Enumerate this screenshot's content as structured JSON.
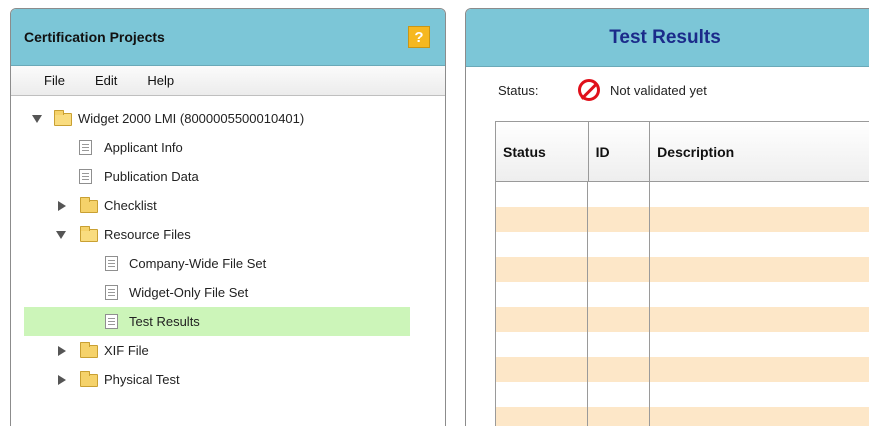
{
  "left_panel": {
    "title": "Certification Projects",
    "help_label": "?",
    "menu": [
      {
        "label": "File"
      },
      {
        "label": "Edit"
      },
      {
        "label": "Help"
      }
    ],
    "tree": [
      {
        "label": "Widget 2000 LMI (8000005500010401)",
        "type": "folder",
        "expanded": true,
        "depth": 0
      },
      {
        "label": "Applicant Info",
        "type": "doc",
        "depth": 1
      },
      {
        "label": "Publication Data",
        "type": "doc",
        "depth": 1
      },
      {
        "label": "Checklist",
        "type": "folder",
        "expanded": false,
        "depth": 1
      },
      {
        "label": "Resource Files",
        "type": "folder",
        "expanded": true,
        "depth": 1
      },
      {
        "label": "Company-Wide File Set",
        "type": "doc",
        "depth": 2
      },
      {
        "label": "Widget-Only File Set",
        "type": "doc",
        "depth": 2
      },
      {
        "label": "Test Results",
        "type": "doc",
        "depth": 2,
        "selected": true
      },
      {
        "label": "XIF File",
        "type": "folder",
        "expanded": false,
        "depth": 1
      },
      {
        "label": "Physical Test",
        "type": "folder",
        "expanded": false,
        "depth": 1
      }
    ]
  },
  "right_panel": {
    "title": "Test Results",
    "status_label": "Status:",
    "status_value": "Not validated yet",
    "status_icon": "no-entry-icon",
    "columns": [
      "Status",
      "ID",
      "Description"
    ],
    "row_count": 10
  },
  "colors": {
    "header_bg": "#7cc6d7",
    "title_blue": "#1b2b8a",
    "selected_row": "#ccf5b9",
    "alt_row": "#fde7c8",
    "help_button": "#f6b820",
    "no_icon": "#e0101b"
  }
}
